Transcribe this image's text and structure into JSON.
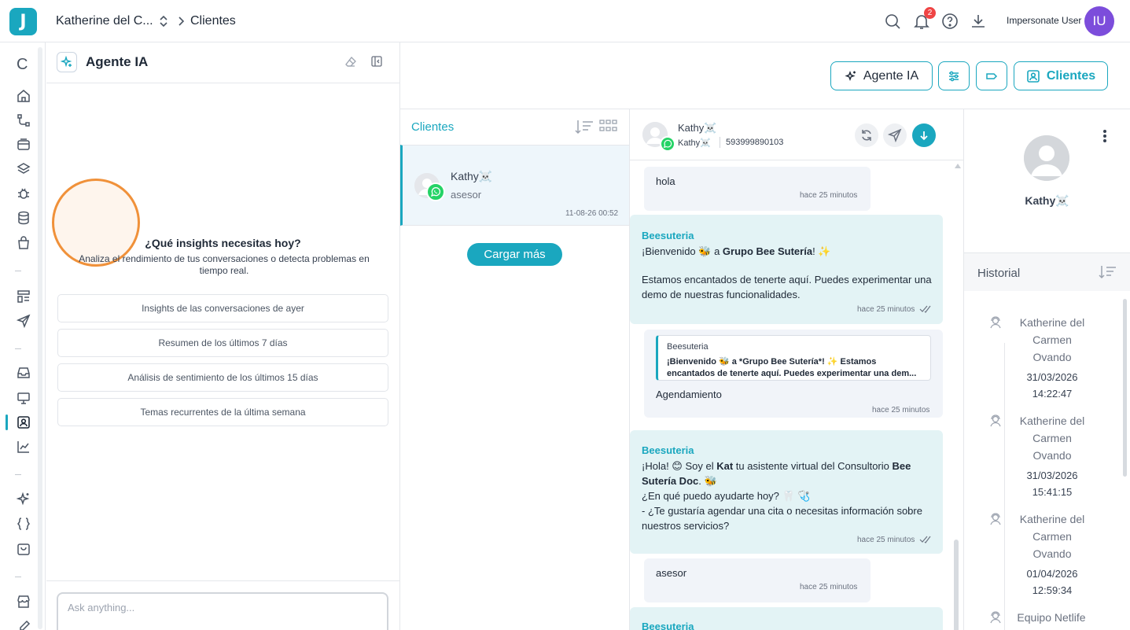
{
  "topbar": {
    "logo_letter": "J",
    "account_name": "Katherine del C...",
    "current_page": "Clientes",
    "notification_count": "2",
    "impersonate_label": "Impersonate User",
    "user_initials": "IU"
  },
  "leftnav": {
    "top_letter": "C"
  },
  "ai_panel": {
    "title": "Agente IA",
    "question": "¿Qué insights necesitas hoy?",
    "subtitle": "Analiza el rendimiento de tus conversaciones o detecta problemas en tiempo real.",
    "suggestions": [
      "Insights de las conversaciones de ayer",
      "Resumen de los últimos 7 días",
      "Análisis de sentimiento de los últimos 15 días",
      "Temas recurrentes de la última semana"
    ],
    "input_placeholder": "Ask anything..."
  },
  "header_buttons": {
    "agente_label": "Agente IA",
    "clientes_label": "Clientes"
  },
  "client_list": {
    "title": "Clientes",
    "items": [
      {
        "name": "Kathy☠️",
        "last_message": "asesor",
        "date": "11-08-26 00:52"
      }
    ],
    "load_more_label": "Cargar más"
  },
  "chat": {
    "contact_name": "Kathy☠️",
    "contact_alias": "Kathy☠️",
    "contact_phone": "593999890103",
    "messages": [
      {
        "direction": "in",
        "text": "hola",
        "time": "hace 25 minutos"
      },
      {
        "direction": "out",
        "sender": "Beesuteria",
        "line1_pre": "¡Bienvenido 🐝 a ",
        "line1_bold": "Grupo Bee Sutería",
        "line1_post": "! ✨",
        "line2": "Estamos encantados de tenerte aquí. Puedes experimentar una demo de nuestras funcionalidades.",
        "time": "hace 25 minutos"
      },
      {
        "direction": "in",
        "quote_sender": "Beesuteria",
        "quote_text": "¡Bienvenido 🐝 a *Grupo Bee Sutería*! ✨ Estamos encantados de tenerte aquí. Puedes experimentar una dem...",
        "text": "Agendamiento",
        "time": "hace 25 minutos"
      },
      {
        "direction": "out",
        "sender": "Beesuteria",
        "p1": "¡Hola! 😊 Soy el ",
        "p1_bold": "Kat",
        "p2": " tu asistente virtual del Consultorio ",
        "p2_bold": "Bee Sutería Doc",
        "p3": ". 🐝",
        "line2": "¿En qué puedo ayudarte hoy? 🦷 🩺",
        "line3": "- ¿Te gustaría agendar una cita o necesitas información sobre nuestros servicios?",
        "time": "hace 25 minutos"
      },
      {
        "direction": "in",
        "text": "asesor",
        "time": "hace 25 minutos"
      },
      {
        "direction": "out",
        "sender": "Beesuteria"
      }
    ]
  },
  "details": {
    "name": "Kathy☠️",
    "history_title": "Historial",
    "history": [
      {
        "agent": "Katherine del Carmen Ovando",
        "date": "31/03/2026",
        "time": "14:22:47"
      },
      {
        "agent": "Katherine del Carmen Ovando",
        "date": "31/03/2026",
        "time": "15:41:15"
      },
      {
        "agent": "Katherine del Carmen Ovando",
        "date": "01/04/2026",
        "time": "12:59:34"
      },
      {
        "agent": "Equipo Netlife"
      }
    ]
  }
}
